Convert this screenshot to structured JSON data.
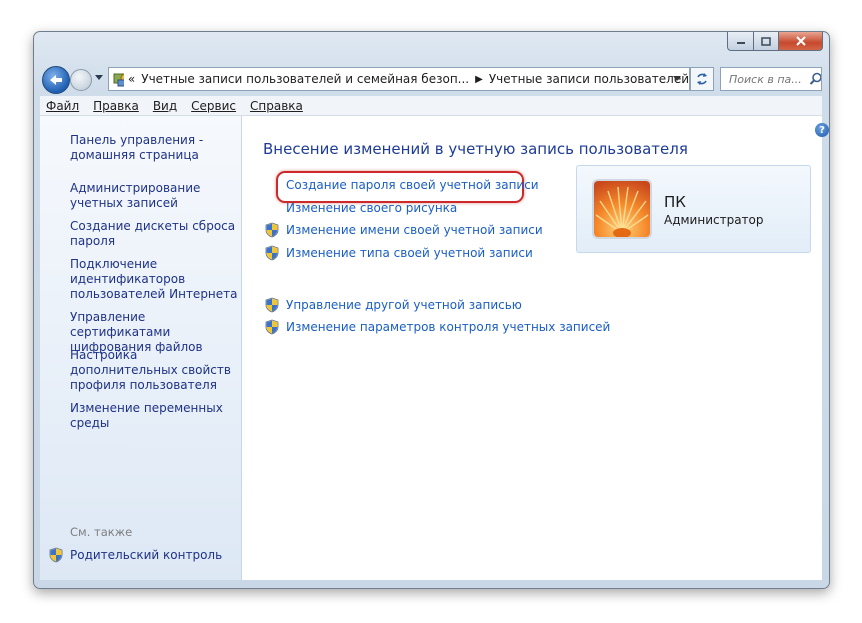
{
  "window": {
    "caption_buttons": [
      "minimize-icon",
      "maximize-icon",
      "close-icon"
    ]
  },
  "navigation": {
    "breadcrumb": [
      "«",
      "Учетные записи пользователей и семейная безоп...",
      "Учетные записи пользователей"
    ],
    "search_placeholder": "Поиск в па..."
  },
  "menu": {
    "items": [
      "Файл",
      "Правка",
      "Вид",
      "Сервис",
      "Справка"
    ]
  },
  "sidebar": {
    "links": [
      "Панель управления - домашняя страница",
      "Администрирование учетных записей",
      "Создание дискеты сброса пароля",
      "Подключение идентификаторов пользователей Интернета",
      "Управление сертификатами шифрования файлов",
      "Настройка дополнительных свойств профиля пользователя",
      "Изменение переменных среды"
    ],
    "see_also": "См. также",
    "parental_control": "Родительский контроль"
  },
  "main": {
    "title": "Внесение изменений в учетную запись пользователя",
    "tasks": [
      {
        "label": "Создание пароля своей учетной записи",
        "shield": false,
        "highlighted": true
      },
      {
        "label": "Изменение своего рисунка",
        "shield": false
      },
      {
        "label": "Изменение имени своей учетной записи",
        "shield": true
      },
      {
        "label": "Изменение типа своей учетной записи",
        "shield": true
      },
      {
        "label": "Управление другой учетной записью",
        "shield": true
      },
      {
        "label": "Изменение параметров контроля учетных записей",
        "shield": true
      }
    ],
    "help_icon": "?"
  },
  "user": {
    "name": "ПК",
    "role": "Администратор"
  },
  "colors": {
    "link": "#1a5ec4",
    "title": "#1e3c96",
    "highlight": "#cc2a2a"
  }
}
